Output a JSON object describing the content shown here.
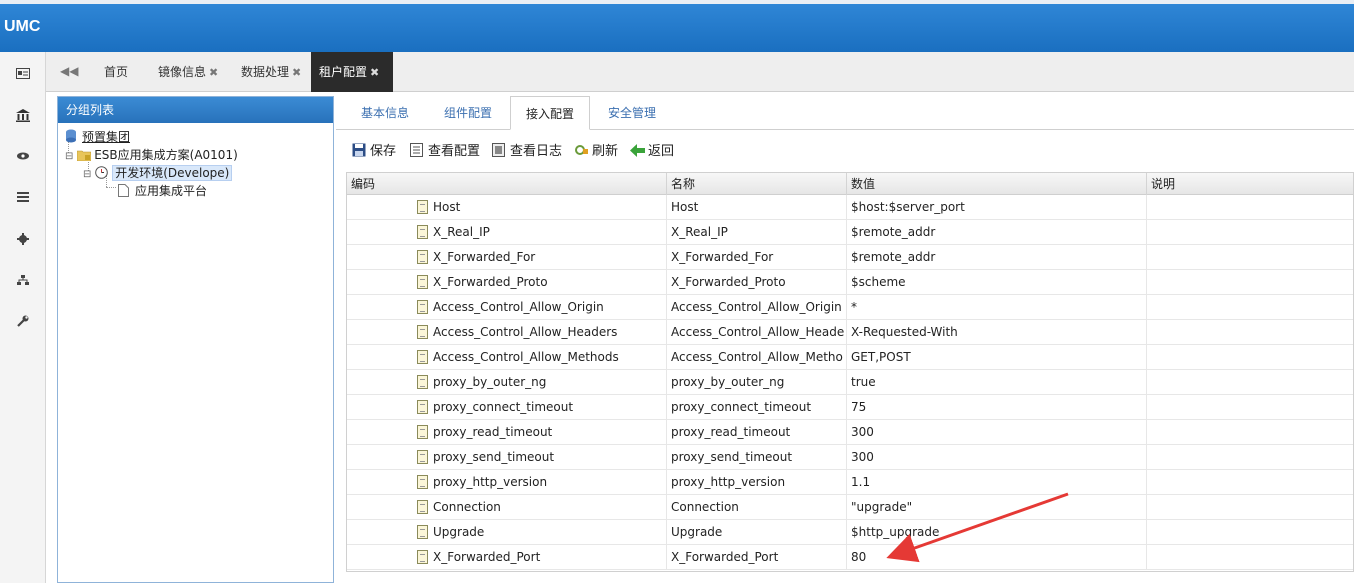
{
  "app": {
    "logo": "UMC"
  },
  "tabs": {
    "back_icon": "double-left-icon",
    "items": [
      {
        "label": "首页",
        "closable": false
      },
      {
        "label": "镜像信息",
        "closable": true
      },
      {
        "label": "数据处理",
        "closable": true
      },
      {
        "label": "租户配置",
        "closable": true,
        "active": true
      }
    ],
    "close_glyph": "✖"
  },
  "group_panel": {
    "title": "分组列表",
    "tree": {
      "root": "预置集团",
      "solution": "ESB应用集成方案(A0101)",
      "env": "开发环境(Develope)",
      "leaf": "应用集成平台"
    }
  },
  "main": {
    "tabs": [
      {
        "label": "基本信息"
      },
      {
        "label": "组件配置"
      },
      {
        "label": "接入配置",
        "active": true
      },
      {
        "label": "安全管理"
      }
    ],
    "toolbar": {
      "save": "保存",
      "view_config": "查看配置",
      "view_log": "查看日志",
      "refresh": "刷新",
      "back": "返回"
    },
    "grid": {
      "headers": [
        "编码",
        "名称",
        "数值",
        "说明"
      ],
      "rows": [
        {
          "code": "Host",
          "name": "Host",
          "value": "$host:$server_port",
          "desc": ""
        },
        {
          "code": "X_Real_IP",
          "name": "X_Real_IP",
          "value": "$remote_addr",
          "desc": ""
        },
        {
          "code": "X_Forwarded_For",
          "name": "X_Forwarded_For",
          "value": "$remote_addr",
          "desc": ""
        },
        {
          "code": "X_Forwarded_Proto",
          "name": "X_Forwarded_Proto",
          "value": "$scheme",
          "desc": ""
        },
        {
          "code": "Access_Control_Allow_Origin",
          "name": "Access_Control_Allow_Origin",
          "value": "*",
          "desc": ""
        },
        {
          "code": "Access_Control_Allow_Headers",
          "name": "Access_Control_Allow_Heade",
          "value": "X-Requested-With",
          "desc": ""
        },
        {
          "code": "Access_Control_Allow_Methods",
          "name": "Access_Control_Allow_Metho",
          "value": "GET,POST",
          "desc": ""
        },
        {
          "code": "proxy_by_outer_ng",
          "name": "proxy_by_outer_ng",
          "value": "true",
          "desc": ""
        },
        {
          "code": "proxy_connect_timeout",
          "name": "proxy_connect_timeout",
          "value": "75",
          "desc": ""
        },
        {
          "code": "proxy_read_timeout",
          "name": "proxy_read_timeout",
          "value": "300",
          "desc": ""
        },
        {
          "code": "proxy_send_timeout",
          "name": "proxy_send_timeout",
          "value": "300",
          "desc": ""
        },
        {
          "code": "proxy_http_version",
          "name": "proxy_http_version",
          "value": "1.1",
          "desc": ""
        },
        {
          "code": "Connection",
          "name": "Connection",
          "value": "\"upgrade\"",
          "desc": ""
        },
        {
          "code": "Upgrade",
          "name": "Upgrade",
          "value": "$http_upgrade",
          "desc": ""
        },
        {
          "code": "X_Forwarded_Port",
          "name": "X_Forwarded_Port",
          "value": "80",
          "desc": ""
        }
      ]
    }
  },
  "annotation": {
    "arrow_color": "#e53935"
  }
}
